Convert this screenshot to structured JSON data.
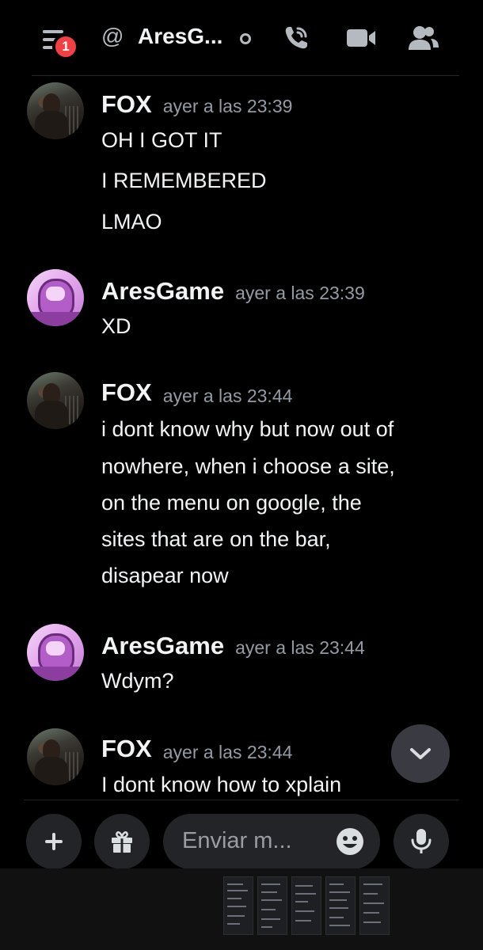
{
  "header": {
    "notification_count": "1",
    "at_symbol": "@",
    "channel_name": "AresG..."
  },
  "messages": [
    {
      "author": "FOX",
      "timestamp": "ayer a las 23:39",
      "lines": [
        "OH I GOT IT",
        "I REMEMBERED",
        "LMAO"
      ]
    },
    {
      "author": "AresGame",
      "timestamp": "ayer a las 23:39",
      "lines": [
        "XD"
      ]
    },
    {
      "author": "FOX",
      "timestamp": "ayer a las 23:44",
      "lines": [
        "i dont know why but now out of",
        "nowhere, when i choose a site,",
        "on the menu on google, the",
        "sites that are on the bar,",
        "disapear now"
      ]
    },
    {
      "author": "AresGame",
      "timestamp": "ayer a las 23:44",
      "lines": [
        "Wdym?"
      ]
    },
    {
      "author": "FOX",
      "timestamp": "ayer a las 23:44",
      "lines": [
        "I dont know how to xplain"
      ]
    }
  ],
  "composer": {
    "placeholder": "Enviar m..."
  },
  "colors": {
    "background": "#000000",
    "badge": "#f23f43",
    "button_bg": "#232428",
    "timestamp": "#949ba4"
  }
}
